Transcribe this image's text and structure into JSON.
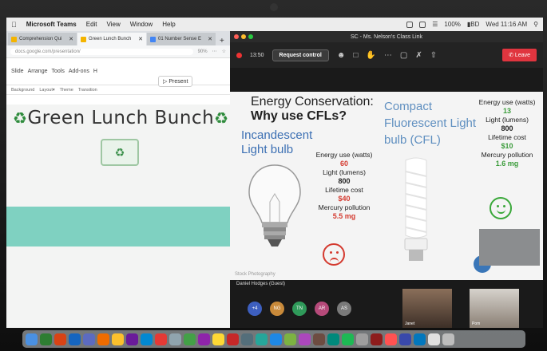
{
  "menubar": {
    "app_name": "Microsoft Teams",
    "menus": [
      "Edit",
      "View",
      "Window",
      "Help"
    ],
    "battery": "100%",
    "battery_label": "▮BD",
    "clock": "Wed 11:16 AM"
  },
  "browser": {
    "tabs": [
      {
        "label": "Comprehension Qui",
        "icon": "slides-icon"
      },
      {
        "label": "Green Lunch Bunch",
        "icon": "slides-icon"
      },
      {
        "label": "01 Number Sense E",
        "icon": "docs-icon"
      }
    ],
    "url": "docs.google.com/presentation/",
    "zoom": "90%",
    "menus": [
      "Slide",
      "Arrange",
      "Tools",
      "Add-ons",
      "H"
    ],
    "toolbar": [
      "Background",
      "Layout▾",
      "Theme",
      "Transition"
    ],
    "present_label": "Present",
    "slide": {
      "title": "Green Lunch Bunch",
      "recycle_symbol": "♻"
    }
  },
  "zoom": {
    "window_title": "SC - Ms. Nelson's Class Link",
    "timer": "13:50",
    "request_control": "Request control",
    "leave": "Leave",
    "presenter": "Daniel Hodges (Guest)",
    "shared_slide": {
      "title_line1": "Energy Conservation:",
      "title_line2": "Why use CFLs?",
      "incandescent_label": "Incandescent Light bulb",
      "cfl_label": "Compact Fluorescent Light bulb (CFL)",
      "incandescent_stats": [
        {
          "label": "Energy use (watts)",
          "value": "60"
        },
        {
          "label": "Light (lumens)",
          "value": "800"
        },
        {
          "label": "Lifetime cost",
          "value": "$40"
        },
        {
          "label": "Mercury pollution",
          "value": "5.5 mg"
        }
      ],
      "cfl_stats": [
        {
          "label": "Energy use (watts)",
          "value": "13"
        },
        {
          "label": "Light (lumens)",
          "value": "800"
        },
        {
          "label": "Lifetime cost",
          "value": "$10"
        },
        {
          "label": "Mercury pollution",
          "value": "1.6 mg"
        }
      ],
      "watermark": "Stock Photography"
    },
    "participants": [
      {
        "initials": "+4",
        "color": "#3d5fbf"
      },
      {
        "initials": "NG",
        "color": "#c98a3a"
      },
      {
        "initials": "TN",
        "color": "#2f9a5a"
      },
      {
        "initials": "AR",
        "color": "#b64a7a"
      },
      {
        "initials": "AS",
        "color": "#7a7a7a"
      }
    ],
    "video_labels": [
      "Janet",
      "Pom"
    ]
  },
  "colors": {
    "teal": "#7fd1c1",
    "zoom_leave": "#e0353f",
    "incandescent_value": "#d43a2f",
    "cfl_value": "#3b9c3b"
  }
}
